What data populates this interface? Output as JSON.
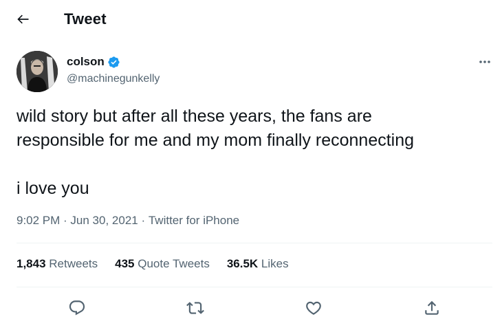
{
  "header": {
    "title": "Tweet"
  },
  "author": {
    "display_name": "colson",
    "handle": "@machinegunkelly"
  },
  "tweet": {
    "text": "wild story but after all these years, the fans are\nresponsible for me and my mom finally reconnecting\n\ni love you",
    "time": "9:02 PM",
    "date": "Jun 30, 2021",
    "source": "Twitter for iPhone",
    "separator": " · "
  },
  "stats": {
    "retweets_count": "1,843",
    "retweets_label": " Retweets",
    "quotes_count": "435",
    "quotes_label": " Quote Tweets",
    "likes_count": "36.5K",
    "likes_label": " Likes"
  },
  "colors": {
    "icon_gray": "#536471",
    "verified_blue": "#1d9bf0",
    "text": "#0f1419",
    "divider": "#eff3f4"
  },
  "icons": [
    "back-arrow-icon",
    "verified-badge-icon",
    "more-icon",
    "reply-icon",
    "retweet-icon",
    "like-icon",
    "share-icon"
  ]
}
